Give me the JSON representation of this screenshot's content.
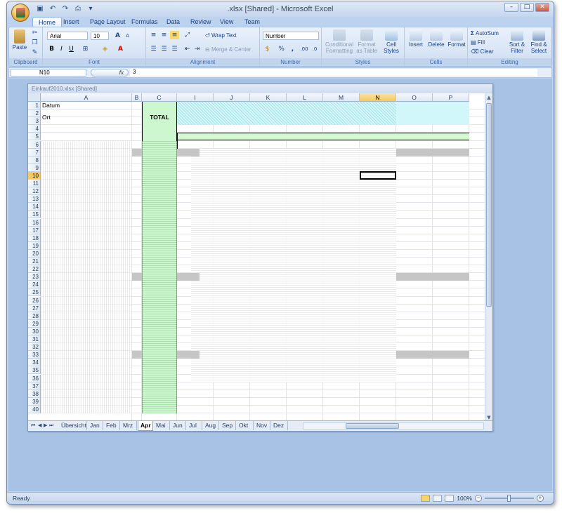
{
  "window": {
    "title": ".xlsx  [Shared] - Microsoft Excel",
    "controls": [
      "–",
      "□",
      "✕"
    ]
  },
  "ribbon_tabs": [
    "Home",
    "Insert",
    "Page Layout",
    "Formulas",
    "Data",
    "Review",
    "View",
    "Team"
  ],
  "active_tab": "Home",
  "clipboard": {
    "paste": "Paste",
    "label": "Clipboard"
  },
  "font": {
    "name": "Arial",
    "size": "10",
    "label": "Font",
    "bold": "B",
    "italic": "I",
    "underline": "U"
  },
  "alignment": {
    "wrap": "Wrap Text",
    "merge": "Merge & Center",
    "label": "Alignment"
  },
  "number": {
    "format": "Number",
    "label": "Number",
    "pct": "%",
    "comma": ",",
    "inc": ".00",
    "dec": ".0"
  },
  "styles": {
    "cond": "Conditional Formatting",
    "table": "Format as Table",
    "cell": "Cell Styles",
    "label": "Styles"
  },
  "cells": {
    "insert": "Insert",
    "delete": "Delete",
    "format": "Format",
    "label": "Cells"
  },
  "editing": {
    "autosum": "AutoSum",
    "fill": "Fill",
    "clear": "Clear",
    "sort": "Sort & Filter",
    "find": "Find & Select",
    "label": "Editing"
  },
  "formula_bar": {
    "name_box": "N10",
    "fx": "fx",
    "value": "3"
  },
  "workbook": {
    "title": "Einkauf2010.xlsx  [Shared]"
  },
  "columns": [
    "A",
    "B",
    "C",
    "I",
    "J",
    "K",
    "L",
    "M",
    "N",
    "O",
    "P"
  ],
  "selected_column": "N",
  "selected_row": "10",
  "rows": [
    "1",
    "2",
    "3",
    "4",
    "5",
    "6",
    "7",
    "8",
    "9",
    "10",
    "11",
    "12",
    "13",
    "14",
    "15",
    "16",
    "17",
    "18",
    "19",
    "20",
    "21",
    "22",
    "23",
    "24",
    "25",
    "26",
    "27",
    "28",
    "29",
    "30",
    "31",
    "32",
    "33",
    "34",
    "35",
    "36",
    "37",
    "38",
    "39",
    "40"
  ],
  "cells_text": {
    "a1": "Datum",
    "a2": "Ort",
    "c2": "TOTAL"
  },
  "sheet_tabs": [
    "Übersicht",
    "Jan",
    "Feb",
    "Mrz",
    "Apr",
    "Mai",
    "Jun",
    "Jul",
    "Aug",
    "Sep",
    "Okt",
    "Nov",
    "Dez"
  ],
  "active_sheet": "Apr",
  "status": {
    "ready": "Ready",
    "zoom": "100%"
  }
}
